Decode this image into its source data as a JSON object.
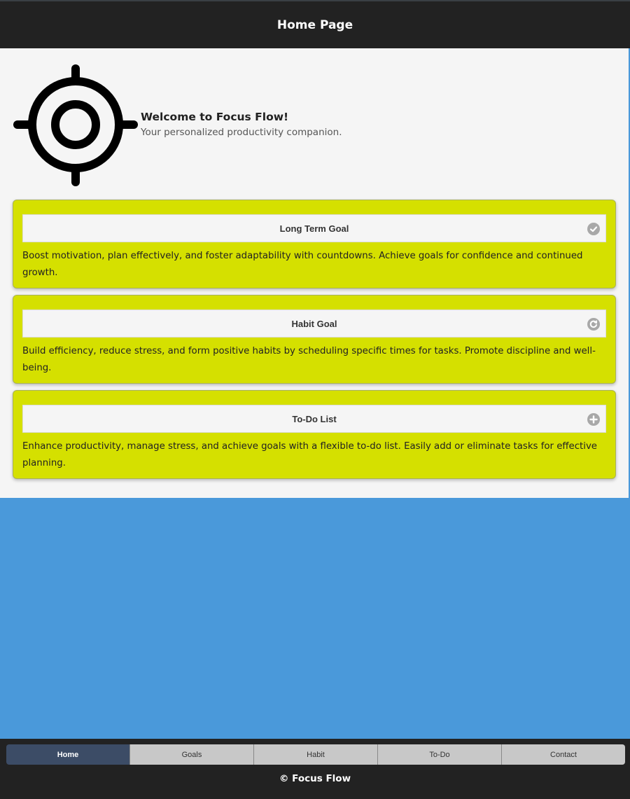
{
  "header": {
    "title": "Home Page"
  },
  "hero": {
    "logo_icon": "target-icon",
    "title": "Welcome to Focus Flow!",
    "subtitle": "Your personalized productivity companion."
  },
  "cards": [
    {
      "title": "Long Term Goal",
      "icon": "check-circle-icon",
      "description": "Boost motivation, plan effectively, and foster adaptability with countdowns. Achieve goals for confidence and continued growth."
    },
    {
      "title": "Habit Goal",
      "icon": "refresh-circle-icon",
      "description": "Build efficiency, reduce stress, and form positive habits by scheduling specific times for tasks. Promote discipline and well-being."
    },
    {
      "title": "To-Do List",
      "icon": "plus-circle-icon",
      "description": "Enhance productivity, manage stress, and achieve goals with a flexible to-do list. Easily add or eliminate tasks for effective planning."
    }
  ],
  "nav": {
    "items": [
      "Home",
      "Goals",
      "Habit",
      "To-Do",
      "Contact"
    ],
    "active": "Home"
  },
  "footer": {
    "copyright": "© Focus Flow"
  },
  "colors": {
    "header_bg": "#222222",
    "card_bg": "#d5e000",
    "page_bg": "#4a99da",
    "nav_active": "#3c4c66",
    "nav_inactive": "#c8c8c8"
  }
}
